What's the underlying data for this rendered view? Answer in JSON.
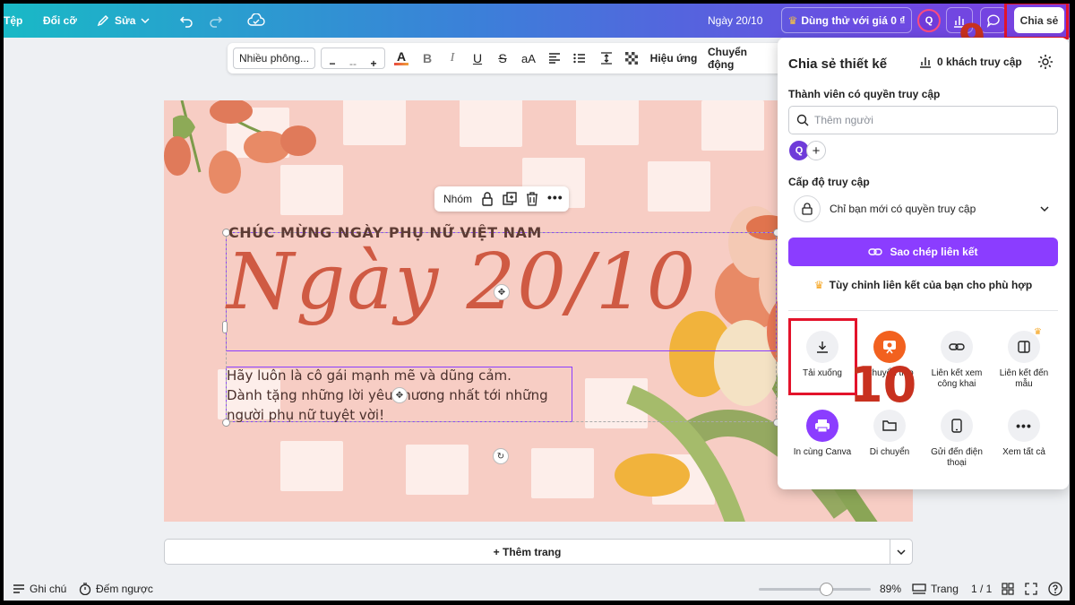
{
  "topbar": {
    "file": "Tệp",
    "resize": "Đổi cỡ",
    "edit": "Sửa",
    "design_title": "Ngày 20/10",
    "trial": "Dùng thử với giá 0 ₫",
    "avatar_initial": "Q",
    "share": "Chia sẻ"
  },
  "annotations": {
    "step9": "9",
    "step10": "10"
  },
  "toolbar": {
    "font": "Nhiều phông...",
    "size_minus": "−",
    "size_value": "--",
    "size_plus": "+",
    "case": "aA",
    "effects": "Hiệu ứng",
    "animate": "Chuyển động"
  },
  "canvas": {
    "group_label": "Nhóm",
    "headline": "CHÚC MỪNG NGÀY PHỤ NỮ VIỆT NAM",
    "script_title": "Ngày 20/10",
    "body_lines": [
      "Hãy luôn là cô gái mạnh mẽ và dũng cảm.",
      "Dành tặng những lời yêu thương nhất tới những",
      "người phụ nữ tuyệt vời!"
    ]
  },
  "add_page": "+ Thêm trang",
  "bottombar": {
    "notes": "Ghi chú",
    "timer": "Đếm ngược",
    "zoom": "89%",
    "zoom_fraction": 0.89,
    "pages": "Trang",
    "page_count": "1 / 1"
  },
  "share_panel": {
    "title": "Chia sẻ thiết kế",
    "visitors": "0 khách truy cập",
    "members_label": "Thành viên có quyền truy cập",
    "add_people_placeholder": "Thêm người",
    "member_initial": "Q",
    "access_level_label": "Cấp độ truy cập",
    "access_level_value": "Chỉ bạn mới có quyền truy cập",
    "copy_link": "Sao chép liên kết",
    "customize_link": "Tùy chỉnh liên kết của bạn cho phù hợp",
    "options": [
      {
        "label": "Tải xuống",
        "icon": "download-icon"
      },
      {
        "label": "Chuyển tiếp",
        "icon": "present-icon"
      },
      {
        "label": "Liên kết xem công khai",
        "icon": "link-icon"
      },
      {
        "label": "Liên kết đến mẫu",
        "icon": "template-link-icon"
      },
      {
        "label": "In cùng Canva",
        "icon": "print-icon"
      },
      {
        "label": "Di chuyển",
        "icon": "folder-icon"
      },
      {
        "label": "Gửi đến điện thoại",
        "icon": "phone-icon"
      },
      {
        "label": "Xem tất cả",
        "icon": "more-icon"
      }
    ]
  },
  "colors": {
    "accent": "#8b3dff",
    "highlight": "#e3132b",
    "canvas_bg": "#f7cdc4",
    "title_script": "#cf5a43"
  }
}
